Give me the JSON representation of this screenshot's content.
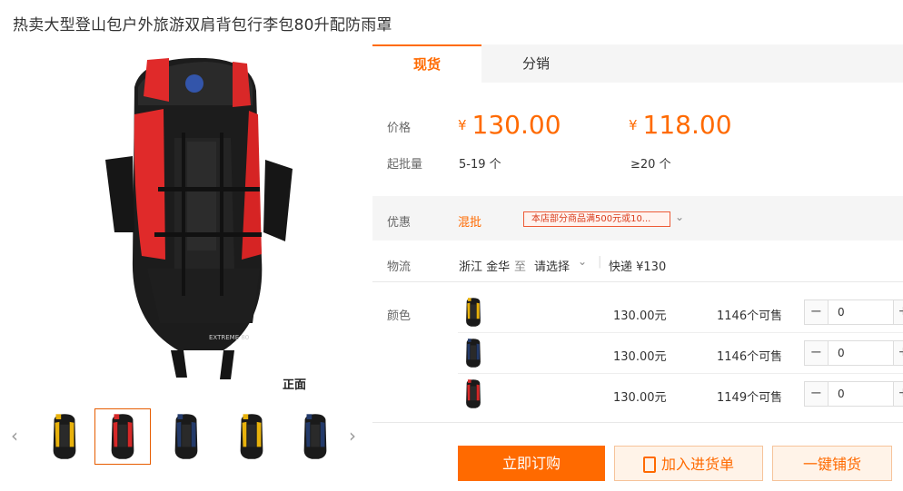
{
  "product": {
    "title": "热卖大型登山包户外旅游双肩背包行李包80升配防雨罩"
  },
  "gallery": {
    "caption": "正面",
    "thumbnail_colors": [
      "yellow",
      "red",
      "navy",
      "yellow",
      "navy"
    ],
    "selected_index": 1
  },
  "tabs": [
    {
      "label": "现货",
      "active": true
    },
    {
      "label": "分销",
      "active": false
    }
  ],
  "pricing": {
    "price_label": "价格",
    "qty_label": "起批量",
    "currency": "¥",
    "tiers": [
      {
        "price": "130.00",
        "qty": "5-19 个"
      },
      {
        "price": "118.00",
        "qty": "≥20 个"
      }
    ]
  },
  "promo": {
    "label": "优惠",
    "type": "混批",
    "tag": "本店部分商品满500元或10..."
  },
  "logistics": {
    "label": "物流",
    "origin": "浙江 金华",
    "to": "至",
    "destination": "请选择",
    "shipping": "快递 ¥130"
  },
  "sku": {
    "label": "颜色",
    "items": [
      {
        "color": "yellow",
        "price": "130.00元",
        "stock": "1146个可售",
        "qty": "0"
      },
      {
        "color": "navy",
        "price": "130.00元",
        "stock": "1146个可售",
        "qty": "0"
      },
      {
        "color": "red",
        "price": "130.00元",
        "stock": "1149个可售",
        "qty": "0"
      }
    ]
  },
  "actions": {
    "buy": "立即订购",
    "cart": "加入进货单",
    "distribute": "一键铺货"
  },
  "colors": {
    "accent": "#ff6a00",
    "band": "#f5f5f5"
  }
}
